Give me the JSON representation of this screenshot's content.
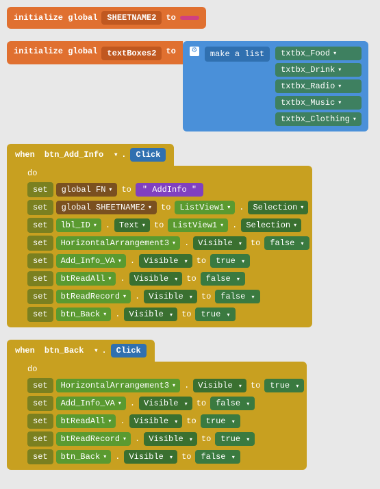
{
  "blocks": {
    "init1": {
      "label": "initialize global",
      "varName": "SHEETNAME2",
      "to": "to",
      "value": ""
    },
    "init2": {
      "label": "initialize global",
      "varName": "textBoxes2",
      "to": "to",
      "makeList": "make a list",
      "items": [
        "txtbx_Food",
        "txtbx_Drink",
        "txtbx_Radio",
        "txtbx_Music",
        "txtbx_Clothing"
      ]
    },
    "when1": {
      "when": "when",
      "btn": "btn_Add_Info",
      "dot": ".",
      "click": "Click",
      "do": "do",
      "rows": [
        {
          "set": "set",
          "comp": "global FN",
          "dot": ".",
          "prop": null,
          "to": "to",
          "value": "AddInfo",
          "valueType": "string"
        },
        {
          "set": "set",
          "comp": "global SHEETNAME2",
          "dot": ".",
          "prop": null,
          "to": "to",
          "listview": "ListView1",
          "dot2": ".",
          "prop2": "Selection"
        },
        {
          "set": "set",
          "comp": "lbl_ID",
          "dot": ".",
          "prop": "Text",
          "to": "to",
          "listview": "ListView1",
          "dot2": ".",
          "prop2": "Selection"
        },
        {
          "set": "set",
          "comp": "HorizontalArrangement3",
          "dot": ".",
          "prop": "Visible",
          "to": "to",
          "value": "false"
        },
        {
          "set": "set",
          "comp": "Add_Info_VA",
          "dot": ".",
          "prop": "Visible",
          "to": "to",
          "value": "true"
        },
        {
          "set": "set",
          "comp": "btReadAll",
          "dot": ".",
          "prop": "Visible",
          "to": "to",
          "value": "false"
        },
        {
          "set": "set",
          "comp": "btReadRecord",
          "dot": ".",
          "prop": "Visible",
          "to": "to",
          "value": "false"
        },
        {
          "set": "set",
          "comp": "btn_Back",
          "dot": ".",
          "prop": "Visible",
          "to": "to",
          "value": "true"
        }
      ]
    },
    "when2": {
      "when": "when",
      "btn": "btn_Back",
      "dot": ".",
      "click": "Click",
      "do": "do",
      "rows": [
        {
          "set": "set",
          "comp": "HorizontalArrangement3",
          "prop": "Visible",
          "to": "to",
          "value": "true"
        },
        {
          "set": "set",
          "comp": "Add_Info_VA",
          "prop": "Visible",
          "to": "to",
          "value": "false"
        },
        {
          "set": "set",
          "comp": "btReadAll",
          "prop": "Visible",
          "to": "to",
          "value": "true"
        },
        {
          "set": "set",
          "comp": "btReadRecord",
          "prop": "Visible",
          "to": "to",
          "value": "true"
        },
        {
          "set": "set",
          "comp": "btn_Back",
          "prop": "Visible",
          "to": "to",
          "value": "false"
        }
      ]
    }
  }
}
